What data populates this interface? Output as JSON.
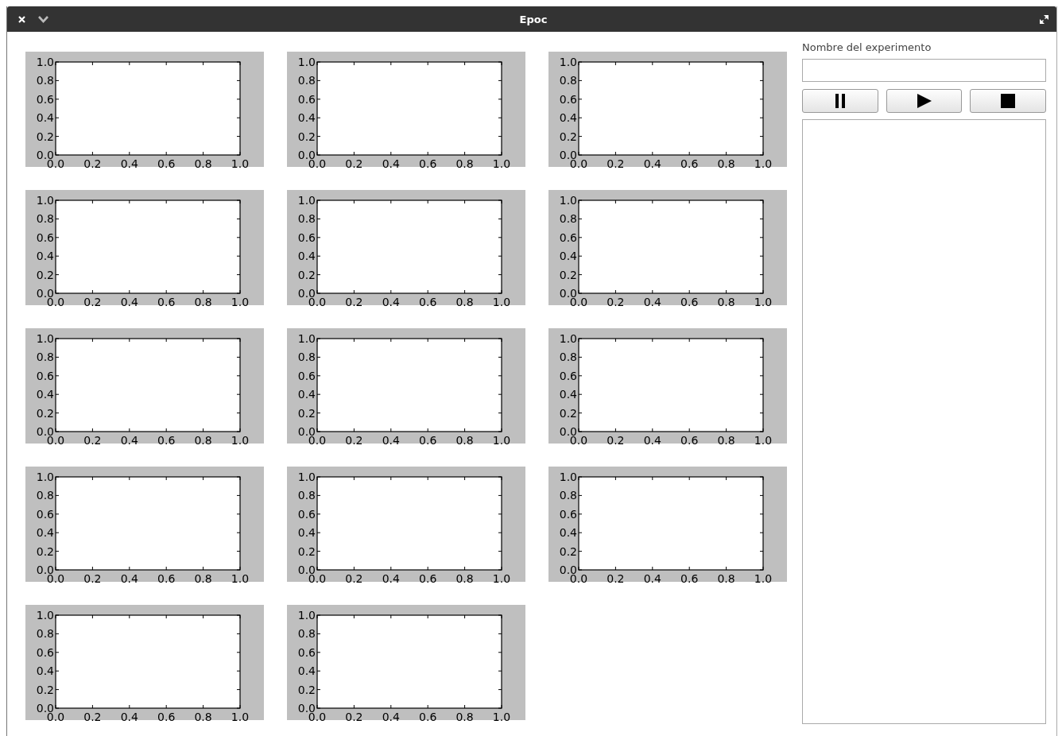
{
  "window": {
    "title": "Epoc"
  },
  "charts": [
    {
      "chart_data": {
        "type": "line",
        "xlim": [
          0,
          1
        ],
        "ylim": [
          0,
          1
        ],
        "xticks": [
          {
            "value": 0,
            "label": "0.0"
          },
          {
            "value": 0.2,
            "label": "0.2"
          },
          {
            "value": 0.4,
            "label": "0.4"
          },
          {
            "value": 0.6,
            "label": "0.6"
          },
          {
            "value": 0.8,
            "label": "0.8"
          },
          {
            "value": 1,
            "label": "1.0"
          }
        ],
        "yticks": [
          {
            "value": 0,
            "label": "0.0"
          },
          {
            "value": 0.2,
            "label": "0.2"
          },
          {
            "value": 0.4,
            "label": "0.4"
          },
          {
            "value": 0.6,
            "label": "0.6"
          },
          {
            "value": 0.8,
            "label": "0.8"
          },
          {
            "value": 1,
            "label": "1.0"
          }
        ]
      }
    },
    {
      "chart_data": {
        "type": "line",
        "xlim": [
          0,
          1
        ],
        "ylim": [
          0,
          1
        ],
        "xticks": [
          {
            "value": 0,
            "label": "0.0"
          },
          {
            "value": 0.2,
            "label": "0.2"
          },
          {
            "value": 0.4,
            "label": "0.4"
          },
          {
            "value": 0.6,
            "label": "0.6"
          },
          {
            "value": 0.8,
            "label": "0.8"
          },
          {
            "value": 1,
            "label": "1.0"
          }
        ],
        "yticks": [
          {
            "value": 0,
            "label": "0.0"
          },
          {
            "value": 0.2,
            "label": "0.2"
          },
          {
            "value": 0.4,
            "label": "0.4"
          },
          {
            "value": 0.6,
            "label": "0.6"
          },
          {
            "value": 0.8,
            "label": "0.8"
          },
          {
            "value": 1,
            "label": "1.0"
          }
        ]
      }
    },
    {
      "chart_data": {
        "type": "line",
        "xlim": [
          0,
          1
        ],
        "ylim": [
          0,
          1
        ],
        "xticks": [
          {
            "value": 0,
            "label": "0.0"
          },
          {
            "value": 0.2,
            "label": "0.2"
          },
          {
            "value": 0.4,
            "label": "0.4"
          },
          {
            "value": 0.6,
            "label": "0.6"
          },
          {
            "value": 0.8,
            "label": "0.8"
          },
          {
            "value": 1,
            "label": "1.0"
          }
        ],
        "yticks": [
          {
            "value": 0,
            "label": "0.0"
          },
          {
            "value": 0.2,
            "label": "0.2"
          },
          {
            "value": 0.4,
            "label": "0.4"
          },
          {
            "value": 0.6,
            "label": "0.6"
          },
          {
            "value": 0.8,
            "label": "0.8"
          },
          {
            "value": 1,
            "label": "1.0"
          }
        ]
      }
    },
    {
      "chart_data": {
        "type": "line",
        "xlim": [
          0,
          1
        ],
        "ylim": [
          0,
          1
        ],
        "xticks": [
          {
            "value": 0,
            "label": "0.0"
          },
          {
            "value": 0.2,
            "label": "0.2"
          },
          {
            "value": 0.4,
            "label": "0.4"
          },
          {
            "value": 0.6,
            "label": "0.6"
          },
          {
            "value": 0.8,
            "label": "0.8"
          },
          {
            "value": 1,
            "label": "1.0"
          }
        ],
        "yticks": [
          {
            "value": 0,
            "label": "0.0"
          },
          {
            "value": 0.2,
            "label": "0.2"
          },
          {
            "value": 0.4,
            "label": "0.4"
          },
          {
            "value": 0.6,
            "label": "0.6"
          },
          {
            "value": 0.8,
            "label": "0.8"
          },
          {
            "value": 1,
            "label": "1.0"
          }
        ]
      }
    },
    {
      "chart_data": {
        "type": "line",
        "xlim": [
          0,
          1
        ],
        "ylim": [
          0,
          1
        ],
        "xticks": [
          {
            "value": 0,
            "label": "0.0"
          },
          {
            "value": 0.2,
            "label": "0.2"
          },
          {
            "value": 0.4,
            "label": "0.4"
          },
          {
            "value": 0.6,
            "label": "0.6"
          },
          {
            "value": 0.8,
            "label": "0.8"
          },
          {
            "value": 1,
            "label": "1.0"
          }
        ],
        "yticks": [
          {
            "value": 0,
            "label": "0.0"
          },
          {
            "value": 0.2,
            "label": "0.2"
          },
          {
            "value": 0.4,
            "label": "0.4"
          },
          {
            "value": 0.6,
            "label": "0.6"
          },
          {
            "value": 0.8,
            "label": "0.8"
          },
          {
            "value": 1,
            "label": "1.0"
          }
        ]
      }
    },
    {
      "chart_data": {
        "type": "line",
        "xlim": [
          0,
          1
        ],
        "ylim": [
          0,
          1
        ],
        "xticks": [
          {
            "value": 0,
            "label": "0.0"
          },
          {
            "value": 0.2,
            "label": "0.2"
          },
          {
            "value": 0.4,
            "label": "0.4"
          },
          {
            "value": 0.6,
            "label": "0.6"
          },
          {
            "value": 0.8,
            "label": "0.8"
          },
          {
            "value": 1,
            "label": "1.0"
          }
        ],
        "yticks": [
          {
            "value": 0,
            "label": "0.0"
          },
          {
            "value": 0.2,
            "label": "0.2"
          },
          {
            "value": 0.4,
            "label": "0.4"
          },
          {
            "value": 0.6,
            "label": "0.6"
          },
          {
            "value": 0.8,
            "label": "0.8"
          },
          {
            "value": 1,
            "label": "1.0"
          }
        ]
      }
    },
    {
      "chart_data": {
        "type": "line",
        "xlim": [
          0,
          1
        ],
        "ylim": [
          0,
          1
        ],
        "xticks": [
          {
            "value": 0,
            "label": "0.0"
          },
          {
            "value": 0.2,
            "label": "0.2"
          },
          {
            "value": 0.4,
            "label": "0.4"
          },
          {
            "value": 0.6,
            "label": "0.6"
          },
          {
            "value": 0.8,
            "label": "0.8"
          },
          {
            "value": 1,
            "label": "1.0"
          }
        ],
        "yticks": [
          {
            "value": 0,
            "label": "0.0"
          },
          {
            "value": 0.2,
            "label": "0.2"
          },
          {
            "value": 0.4,
            "label": "0.4"
          },
          {
            "value": 0.6,
            "label": "0.6"
          },
          {
            "value": 0.8,
            "label": "0.8"
          },
          {
            "value": 1,
            "label": "1.0"
          }
        ]
      }
    },
    {
      "chart_data": {
        "type": "line",
        "xlim": [
          0,
          1
        ],
        "ylim": [
          0,
          1
        ],
        "xticks": [
          {
            "value": 0,
            "label": "0.0"
          },
          {
            "value": 0.2,
            "label": "0.2"
          },
          {
            "value": 0.4,
            "label": "0.4"
          },
          {
            "value": 0.6,
            "label": "0.6"
          },
          {
            "value": 0.8,
            "label": "0.8"
          },
          {
            "value": 1,
            "label": "1.0"
          }
        ],
        "yticks": [
          {
            "value": 0,
            "label": "0.0"
          },
          {
            "value": 0.2,
            "label": "0.2"
          },
          {
            "value": 0.4,
            "label": "0.4"
          },
          {
            "value": 0.6,
            "label": "0.6"
          },
          {
            "value": 0.8,
            "label": "0.8"
          },
          {
            "value": 1,
            "label": "1.0"
          }
        ]
      }
    },
    {
      "chart_data": {
        "type": "line",
        "xlim": [
          0,
          1
        ],
        "ylim": [
          0,
          1
        ],
        "xticks": [
          {
            "value": 0,
            "label": "0.0"
          },
          {
            "value": 0.2,
            "label": "0.2"
          },
          {
            "value": 0.4,
            "label": "0.4"
          },
          {
            "value": 0.6,
            "label": "0.6"
          },
          {
            "value": 0.8,
            "label": "0.8"
          },
          {
            "value": 1,
            "label": "1.0"
          }
        ],
        "yticks": [
          {
            "value": 0,
            "label": "0.0"
          },
          {
            "value": 0.2,
            "label": "0.2"
          },
          {
            "value": 0.4,
            "label": "0.4"
          },
          {
            "value": 0.6,
            "label": "0.6"
          },
          {
            "value": 0.8,
            "label": "0.8"
          },
          {
            "value": 1,
            "label": "1.0"
          }
        ]
      }
    },
    {
      "chart_data": {
        "type": "line",
        "xlim": [
          0,
          1
        ],
        "ylim": [
          0,
          1
        ],
        "xticks": [
          {
            "value": 0,
            "label": "0.0"
          },
          {
            "value": 0.2,
            "label": "0.2"
          },
          {
            "value": 0.4,
            "label": "0.4"
          },
          {
            "value": 0.6,
            "label": "0.6"
          },
          {
            "value": 0.8,
            "label": "0.8"
          },
          {
            "value": 1,
            "label": "1.0"
          }
        ],
        "yticks": [
          {
            "value": 0,
            "label": "0.0"
          },
          {
            "value": 0.2,
            "label": "0.2"
          },
          {
            "value": 0.4,
            "label": "0.4"
          },
          {
            "value": 0.6,
            "label": "0.6"
          },
          {
            "value": 0.8,
            "label": "0.8"
          },
          {
            "value": 1,
            "label": "1.0"
          }
        ]
      }
    },
    {
      "chart_data": {
        "type": "line",
        "xlim": [
          0,
          1
        ],
        "ylim": [
          0,
          1
        ],
        "xticks": [
          {
            "value": 0,
            "label": "0.0"
          },
          {
            "value": 0.2,
            "label": "0.2"
          },
          {
            "value": 0.4,
            "label": "0.4"
          },
          {
            "value": 0.6,
            "label": "0.6"
          },
          {
            "value": 0.8,
            "label": "0.8"
          },
          {
            "value": 1,
            "label": "1.0"
          }
        ],
        "yticks": [
          {
            "value": 0,
            "label": "0.0"
          },
          {
            "value": 0.2,
            "label": "0.2"
          },
          {
            "value": 0.4,
            "label": "0.4"
          },
          {
            "value": 0.6,
            "label": "0.6"
          },
          {
            "value": 0.8,
            "label": "0.8"
          },
          {
            "value": 1,
            "label": "1.0"
          }
        ]
      }
    },
    {
      "chart_data": {
        "type": "line",
        "xlim": [
          0,
          1
        ],
        "ylim": [
          0,
          1
        ],
        "xticks": [
          {
            "value": 0,
            "label": "0.0"
          },
          {
            "value": 0.2,
            "label": "0.2"
          },
          {
            "value": 0.4,
            "label": "0.4"
          },
          {
            "value": 0.6,
            "label": "0.6"
          },
          {
            "value": 0.8,
            "label": "0.8"
          },
          {
            "value": 1,
            "label": "1.0"
          }
        ],
        "yticks": [
          {
            "value": 0,
            "label": "0.0"
          },
          {
            "value": 0.2,
            "label": "0.2"
          },
          {
            "value": 0.4,
            "label": "0.4"
          },
          {
            "value": 0.6,
            "label": "0.6"
          },
          {
            "value": 0.8,
            "label": "0.8"
          },
          {
            "value": 1,
            "label": "1.0"
          }
        ]
      }
    },
    {
      "chart_data": {
        "type": "line",
        "xlim": [
          0,
          1
        ],
        "ylim": [
          0,
          1
        ],
        "xticks": [
          {
            "value": 0,
            "label": "0.0"
          },
          {
            "value": 0.2,
            "label": "0.2"
          },
          {
            "value": 0.4,
            "label": "0.4"
          },
          {
            "value": 0.6,
            "label": "0.6"
          },
          {
            "value": 0.8,
            "label": "0.8"
          },
          {
            "value": 1,
            "label": "1.0"
          }
        ],
        "yticks": [
          {
            "value": 0,
            "label": "0.0"
          },
          {
            "value": 0.2,
            "label": "0.2"
          },
          {
            "value": 0.4,
            "label": "0.4"
          },
          {
            "value": 0.6,
            "label": "0.6"
          },
          {
            "value": 0.8,
            "label": "0.8"
          },
          {
            "value": 1,
            "label": "1.0"
          }
        ]
      }
    },
    {
      "chart_data": {
        "type": "line",
        "xlim": [
          0,
          1
        ],
        "ylim": [
          0,
          1
        ],
        "xticks": [
          {
            "value": 0,
            "label": "0.0"
          },
          {
            "value": 0.2,
            "label": "0.2"
          },
          {
            "value": 0.4,
            "label": "0.4"
          },
          {
            "value": 0.6,
            "label": "0.6"
          },
          {
            "value": 0.8,
            "label": "0.8"
          },
          {
            "value": 1,
            "label": "1.0"
          }
        ],
        "yticks": [
          {
            "value": 0,
            "label": "0.0"
          },
          {
            "value": 0.2,
            "label": "0.2"
          },
          {
            "value": 0.4,
            "label": "0.4"
          },
          {
            "value": 0.6,
            "label": "0.6"
          },
          {
            "value": 0.8,
            "label": "0.8"
          },
          {
            "value": 1,
            "label": "1.0"
          }
        ]
      }
    }
  ],
  "experiment": {
    "label": "Nombre del experimento"
  },
  "controls": [
    {
      "kind": "pause"
    },
    {
      "kind": "play"
    },
    {
      "kind": "stop"
    }
  ]
}
